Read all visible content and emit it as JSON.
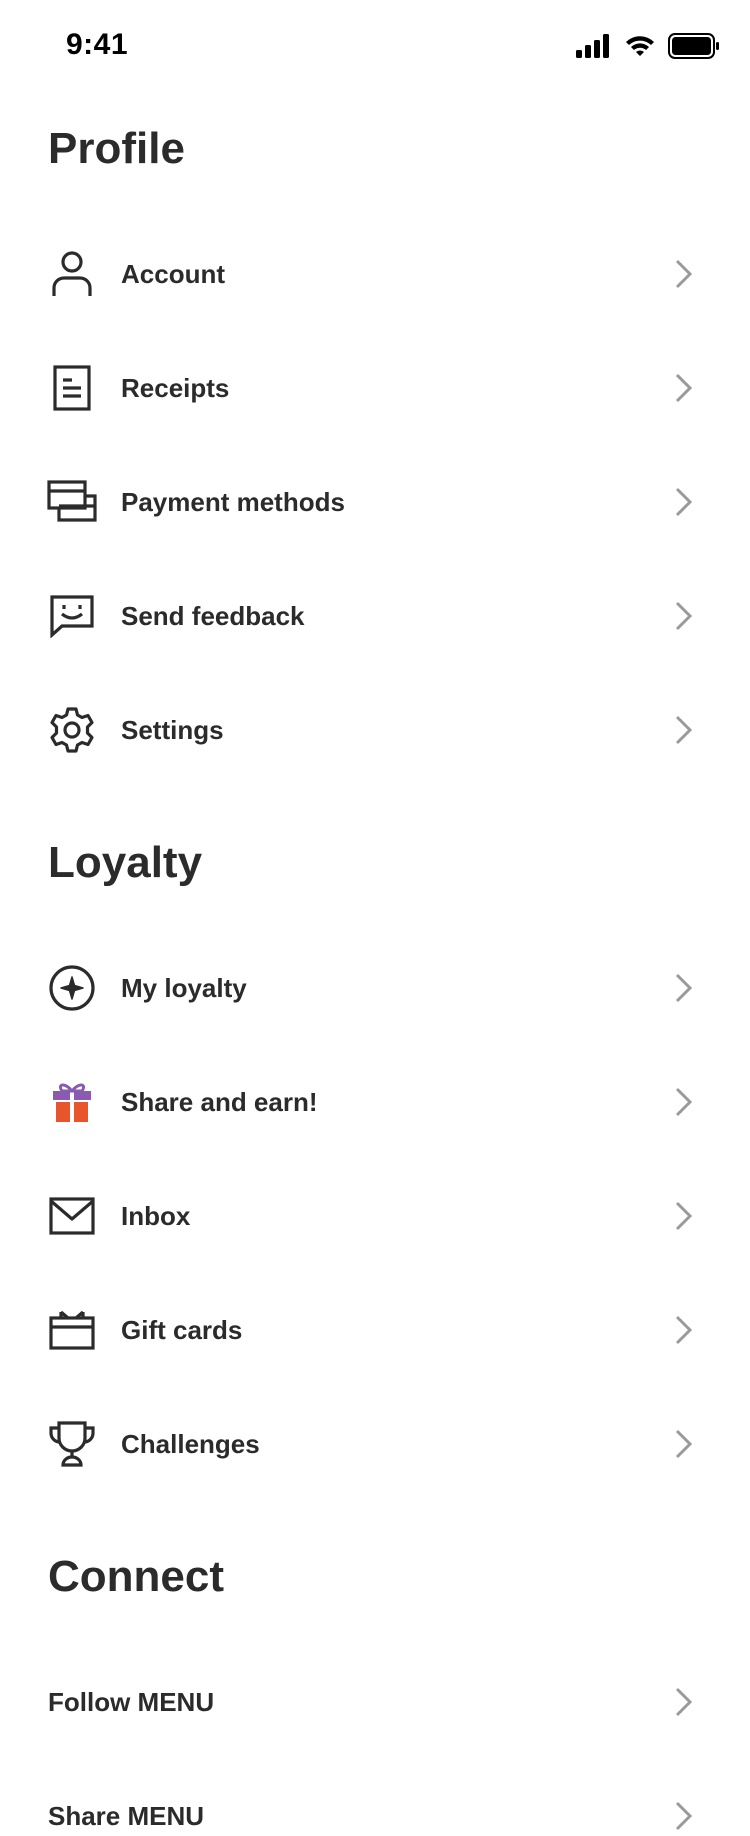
{
  "status_bar": {
    "time": "9:41"
  },
  "profile": {
    "title": "Profile",
    "items": [
      {
        "label": "Account",
        "icon": "person-icon"
      },
      {
        "label": "Receipts",
        "icon": "receipt-icon"
      },
      {
        "label": "Payment methods",
        "icon": "credit-card-icon"
      },
      {
        "label": "Send feedback",
        "icon": "feedback-smile-icon"
      },
      {
        "label": "Settings",
        "icon": "gear-icon"
      }
    ]
  },
  "loyalty": {
    "title": "Loyalty",
    "items": [
      {
        "label": "My loyalty",
        "icon": "star-compass-icon"
      },
      {
        "label": "Share and earn!",
        "icon": "gift-icon"
      },
      {
        "label": "Inbox",
        "icon": "envelope-icon"
      },
      {
        "label": "Gift cards",
        "icon": "gift-card-icon"
      },
      {
        "label": "Challenges",
        "icon": "trophy-icon"
      }
    ]
  },
  "connect": {
    "title": "Connect",
    "items": [
      {
        "label": "Follow MENU"
      },
      {
        "label": "Share MENU"
      }
    ]
  },
  "colors": {
    "text": "#2b2b2b",
    "chevron": "#9a9a9a",
    "gift_box": "#e8542c",
    "gift_ribbon": "#8a5bb0"
  }
}
